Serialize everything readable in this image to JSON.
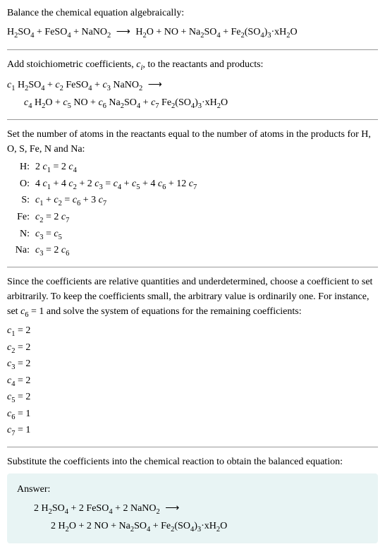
{
  "intro_line1": "Balance the chemical equation algebraically:",
  "intro_eq": "H₂SO₄ + FeSO₄ + NaNO₂ ⟶ H₂O + NO + Na₂SO₄ + Fe₂(SO₄)₃·xH₂O",
  "stoich_line": "Add stoichiometric coefficients, cᵢ, to the reactants and products:",
  "stoich_eq_l1": "c₁ H₂SO₄ + c₂ FeSO₄ + c₃ NaNO₂ ⟶",
  "stoich_eq_l2": "c₄ H₂O + c₅ NO + c₆ Na₂SO₄ + c₇ Fe₂(SO₄)₃·xH₂O",
  "atoms_intro": "Set the number of atoms in the reactants equal to the number of atoms in the products for H, O, S, Fe, N and Na:",
  "atoms": [
    {
      "el": "H:",
      "eq": "2 c₁ = 2 c₄"
    },
    {
      "el": "O:",
      "eq": "4 c₁ + 4 c₂ + 2 c₃ = c₄ + c₅ + 4 c₆ + 12 c₇"
    },
    {
      "el": "S:",
      "eq": "c₁ + c₂ = c₆ + 3 c₇"
    },
    {
      "el": "Fe:",
      "eq": "c₂ = 2 c₇"
    },
    {
      "el": "N:",
      "eq": "c₃ = c₅"
    },
    {
      "el": "Na:",
      "eq": "c₃ = 2 c₆"
    }
  ],
  "underdet": "Since the coefficients are relative quantities and underdetermined, choose a coefficient to set arbitrarily. To keep the coefficients small, the arbitrary value is ordinarily one. For instance, set c₆ = 1 and solve the system of equations for the remaining coefficients:",
  "coeffs": [
    "c₁ = 2",
    "c₂ = 2",
    "c₃ = 2",
    "c₄ = 2",
    "c₅ = 2",
    "c₆ = 1",
    "c₇ = 1"
  ],
  "subst": "Substitute the coefficients into the chemical reaction to obtain the balanced equation:",
  "answer_label": "Answer:",
  "answer_l1": "2 H₂SO₄ + 2 FeSO₄ + 2 NaNO₂ ⟶",
  "answer_l2": "2 H₂O + 2 NO + Na₂SO₄ + Fe₂(SO₄)₃·xH₂O",
  "chart_data": {
    "type": "table",
    "title": "Balanced chemical equation coefficients",
    "reactants": [
      {
        "species": "H2SO4",
        "coefficient": 2
      },
      {
        "species": "FeSO4",
        "coefficient": 2
      },
      {
        "species": "NaNO2",
        "coefficient": 2
      }
    ],
    "products": [
      {
        "species": "H2O",
        "coefficient": 2
      },
      {
        "species": "NO",
        "coefficient": 2
      },
      {
        "species": "Na2SO4",
        "coefficient": 1
      },
      {
        "species": "Fe2(SO4)3·xH2O",
        "coefficient": 1
      }
    ],
    "atom_balance": {
      "H": "2c1 = 2c4",
      "O": "4c1 + 4c2 + 2c3 = c4 + c5 + 4c6 + 12c7",
      "S": "c1 + c2 = c6 + 3c7",
      "Fe": "c2 = 2c7",
      "N": "c3 = c5",
      "Na": "c3 = 2c6"
    },
    "solution": {
      "c1": 2,
      "c2": 2,
      "c3": 2,
      "c4": 2,
      "c5": 2,
      "c6": 1,
      "c7": 1
    }
  }
}
